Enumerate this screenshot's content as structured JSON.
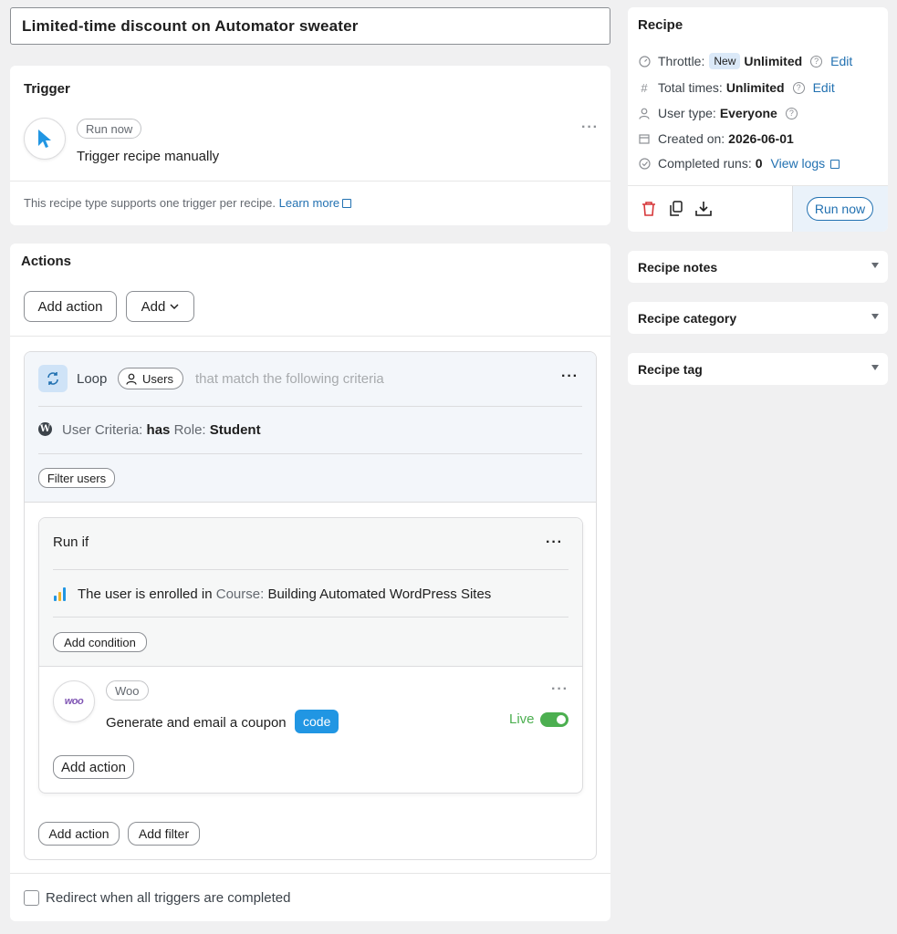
{
  "title": "Limited-time discount on Automator sweater",
  "trigger": {
    "heading": "Trigger",
    "run_now_pill": "Run now",
    "sentence": "Trigger recipe manually",
    "note": "This recipe type supports one trigger per recipe.",
    "learn_more": "Learn more"
  },
  "actions": {
    "heading": "Actions",
    "add_action": "Add action",
    "add": "Add",
    "loop": {
      "label": "Loop",
      "users": "Users",
      "criteria": "that match the following criteria",
      "uc_label": "User Criteria:",
      "uc_has": "has",
      "uc_role": "Role:",
      "uc_value": "Student",
      "filter_users": "Filter users"
    },
    "run_if": {
      "label": "Run if",
      "cond_prefix": "The user is enrolled in",
      "cond_key": "Course:",
      "cond_value": "Building Automated WordPress Sites",
      "add_condition": "Add condition",
      "woo_pill": "Woo",
      "woo_logo": "woo",
      "action_sentence": "Generate and email a coupon",
      "code_badge": "code",
      "live": "Live",
      "add_action": "Add action"
    },
    "loop_add_action": "Add action",
    "loop_add_filter": "Add filter",
    "redirect": "Redirect when all triggers are completed"
  },
  "recipe": {
    "heading": "Recipe",
    "throttle_label": "Throttle:",
    "throttle_badge": "New",
    "throttle_value": "Unlimited",
    "edit": "Edit",
    "total_label": "Total times:",
    "total_value": "Unlimited",
    "user_type_label": "User type:",
    "user_type_value": "Everyone",
    "created_label": "Created on:",
    "created_value": "2026-06-01",
    "completed_label": "Completed runs:",
    "completed_value": "0",
    "view_logs": "View logs",
    "run_now": "Run now"
  },
  "sidebar": {
    "notes": "Recipe notes",
    "category": "Recipe category",
    "tag": "Recipe tag"
  },
  "colors": {
    "accent": "#2271b1",
    "live_green": "#4caf50",
    "code_blue": "#2196e3",
    "delete_red": "#d63638",
    "woo_purple": "#7f54b3"
  }
}
